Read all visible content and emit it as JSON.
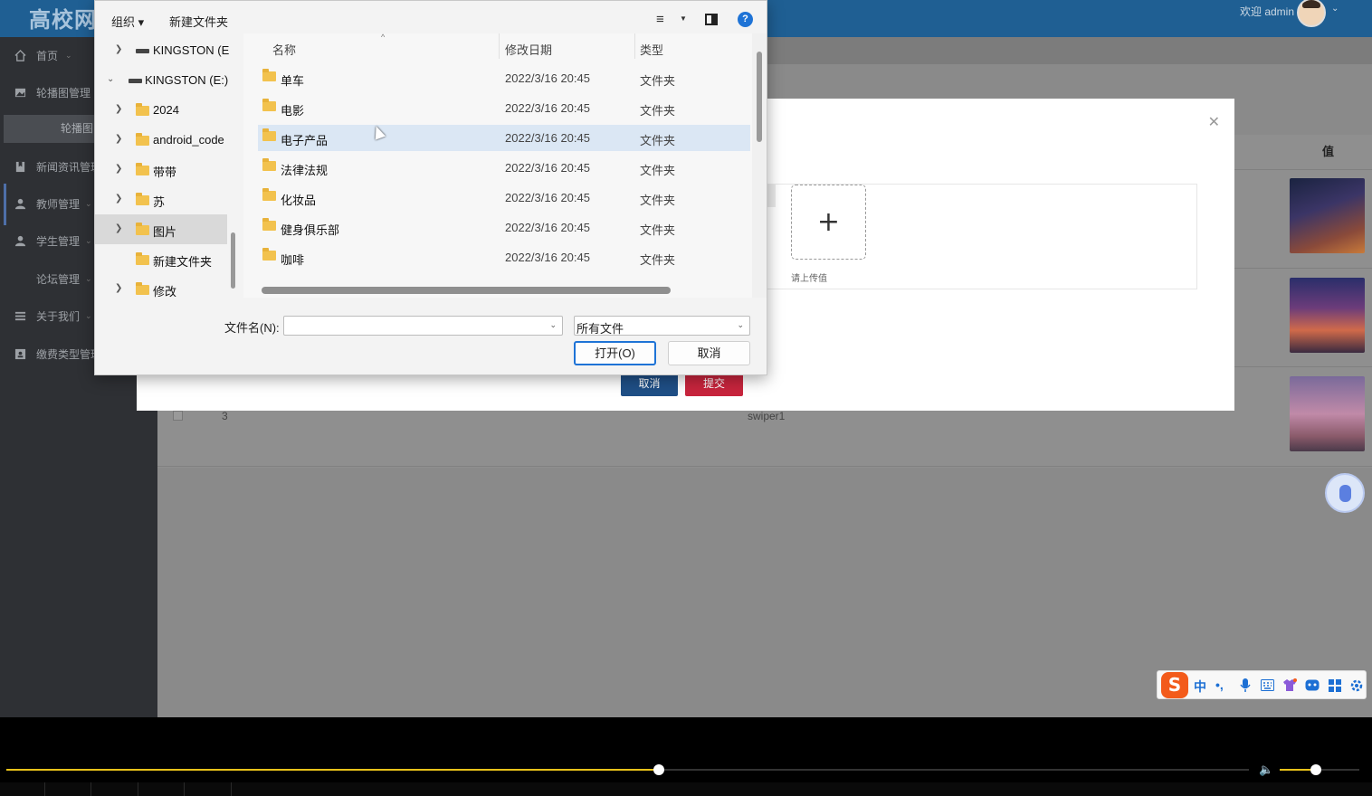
{
  "app": {
    "brand": "高校网",
    "welcome": "欢迎 admin"
  },
  "sidebar": {
    "items": [
      {
        "label": "首页",
        "icon": "home-icon"
      },
      {
        "label": "轮播图管理",
        "icon": "image-icon"
      },
      {
        "label": "新闻资讯管理",
        "icon": "bookmark-icon"
      },
      {
        "label": "教师管理",
        "icon": "user-icon"
      },
      {
        "label": "学生管理",
        "icon": "user-icon"
      },
      {
        "label": "论坛管理",
        "icon": ""
      },
      {
        "label": "关于我们",
        "icon": "list-icon"
      },
      {
        "label": "缴费类型管理",
        "icon": "id-card-icon"
      }
    ],
    "sub_item": "轮播图"
  },
  "table": {
    "value_header": "值",
    "row3_index": "3",
    "row3_name": "swiper1"
  },
  "modal": {
    "upload_tip": "请上传值",
    "cancel": "取消",
    "submit": "提交"
  },
  "dialog": {
    "toolbar": {
      "organize": "组织 ▾",
      "new_folder": "新建文件夹"
    },
    "tree": [
      {
        "label": "KINGSTON (E",
        "kind": "drive",
        "expanded": false,
        "indent": 0
      },
      {
        "label": "KINGSTON (E:)",
        "kind": "drive",
        "expanded": true,
        "indent": 0
      },
      {
        "label": "2024",
        "kind": "folder",
        "expanded": false,
        "indent": 1
      },
      {
        "label": "android_code",
        "kind": "folder",
        "expanded": false,
        "indent": 1
      },
      {
        "label": "带带",
        "kind": "folder",
        "expanded": false,
        "indent": 1
      },
      {
        "label": "苏",
        "kind": "folder",
        "expanded": false,
        "indent": 1
      },
      {
        "label": "图片",
        "kind": "folder",
        "expanded": false,
        "indent": 1,
        "selected": true
      },
      {
        "label": "新建文件夹",
        "kind": "folder",
        "expanded": null,
        "indent": 1
      },
      {
        "label": "修改",
        "kind": "folder",
        "expanded": false,
        "indent": 1
      }
    ],
    "columns": {
      "name": "名称",
      "date": "修改日期",
      "type": "类型"
    },
    "files": [
      {
        "name": "单车",
        "date": "2022/3/16 20:45",
        "type": "文件夹"
      },
      {
        "name": "电影",
        "date": "2022/3/16 20:45",
        "type": "文件夹"
      },
      {
        "name": "电子产品",
        "date": "2022/3/16 20:45",
        "type": "文件夹",
        "hover": true
      },
      {
        "name": "法律法规",
        "date": "2022/3/16 20:45",
        "type": "文件夹"
      },
      {
        "name": "化妆品",
        "date": "2022/3/16 20:45",
        "type": "文件夹"
      },
      {
        "name": "健身俱乐部",
        "date": "2022/3/16 20:45",
        "type": "文件夹"
      },
      {
        "name": "咖啡",
        "date": "2022/3/16 20:45",
        "type": "文件夹"
      }
    ],
    "filename_label": "文件名(N):",
    "filename_value": "",
    "filetype": "所有文件",
    "open": "打开(O)",
    "cancel": "取消"
  },
  "ime": {
    "logo": "S",
    "mode": "中",
    "punct": "•,"
  },
  "player": {
    "progress": 0.525,
    "volume": 0.45,
    "accent": "#e8c21a"
  }
}
